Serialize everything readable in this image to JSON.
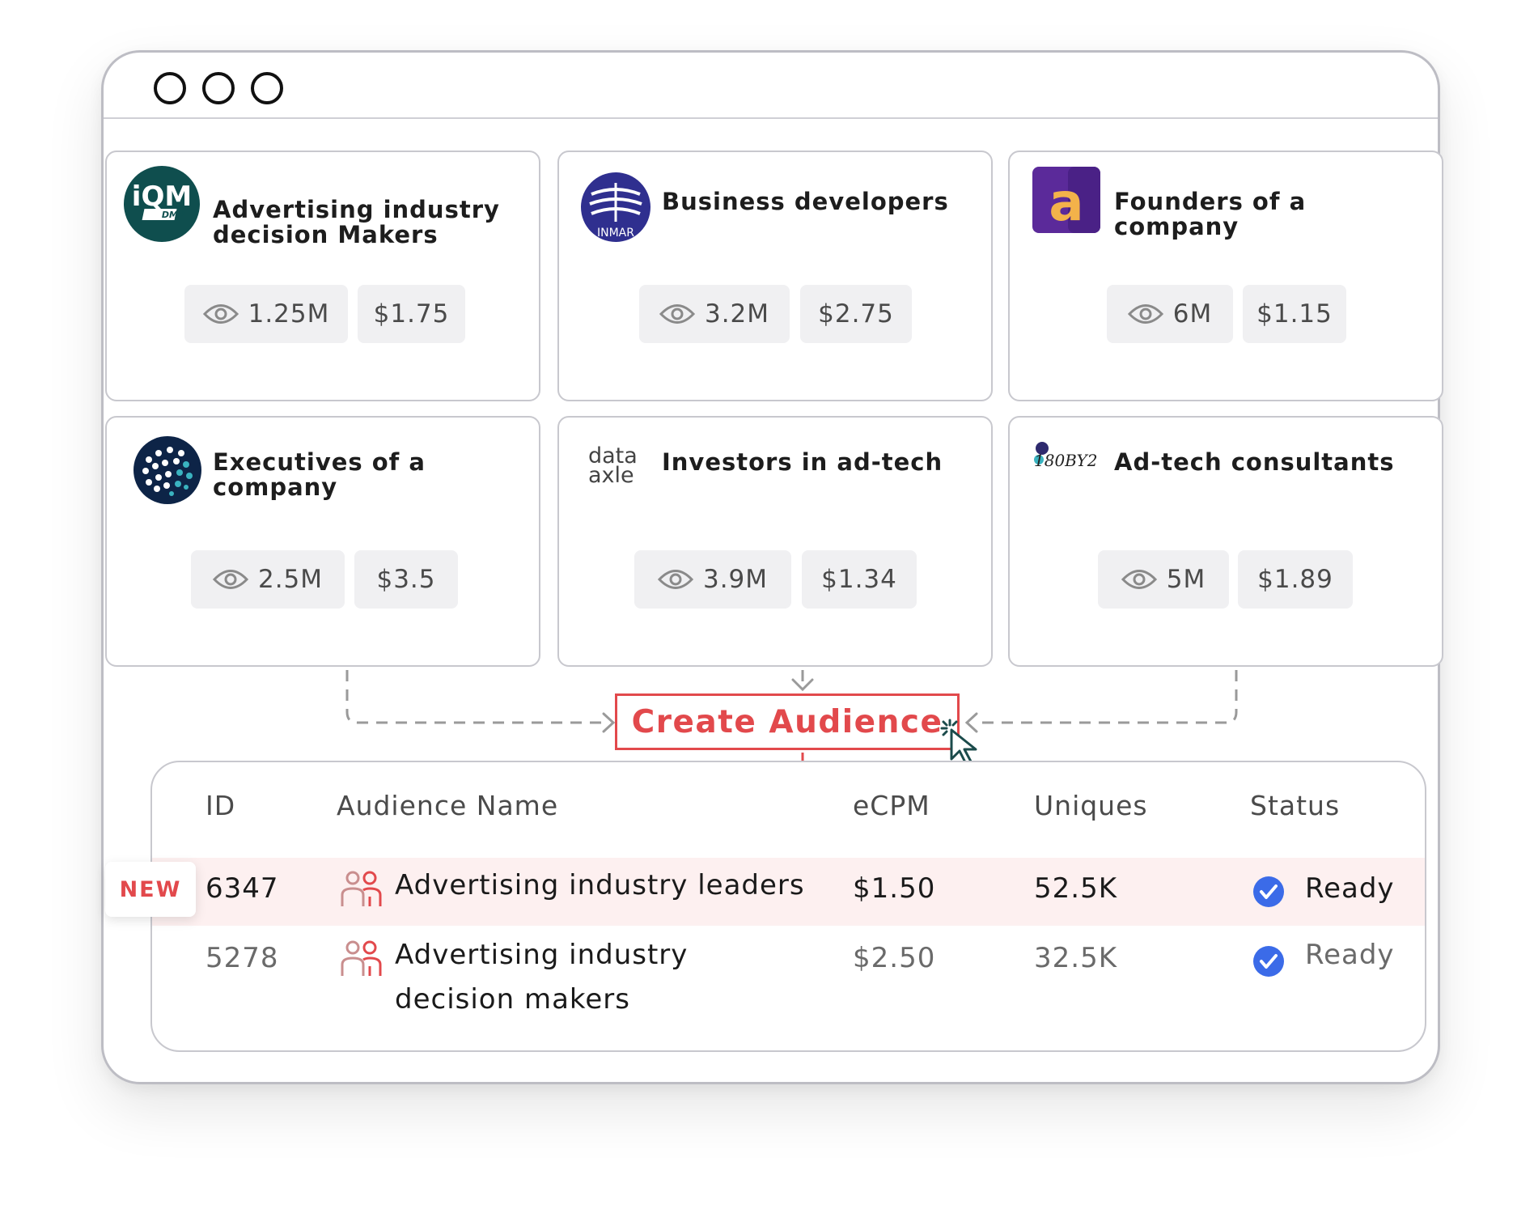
{
  "window": {
    "controls": [
      "window-dot-1",
      "window-dot-2",
      "window-dot-3"
    ]
  },
  "cards": [
    {
      "title_line1": "Advertising industry",
      "title_line2": "decision Makers",
      "logo": "iqm-dmp-logo",
      "logo_text": "iQM",
      "logo_sub": "DMP",
      "reach": "1.25M",
      "price": "$1.75"
    },
    {
      "title_line1": "Business developers",
      "title_line2": "",
      "logo": "inmar-logo",
      "logo_text": "INMAR",
      "reach": "3.2M",
      "price": "$2.75"
    },
    {
      "title_line1": "Founders of a",
      "title_line2": "company",
      "logo": "a-letter-logo",
      "logo_text": "a",
      "reach": "6M",
      "price": "$1.15"
    },
    {
      "title_line1": "Executives of a",
      "title_line2": "company",
      "logo": "dotted-globe-logo",
      "reach": "2.5M",
      "price": "$3.5"
    },
    {
      "title_line1": "Investors in ad-tech",
      "title_line2": "",
      "logo": "data-axle-logo",
      "logo_text": "data",
      "logo_sub": "axle",
      "reach": "3.9M",
      "price": "$1.34"
    },
    {
      "title_line1": "Ad-tech consultants",
      "title_line2": "",
      "logo": "180by2-logo",
      "logo_text": "180BY2",
      "reach": "5M",
      "price": "$1.89"
    }
  ],
  "create_button": {
    "label": "Create Audience"
  },
  "table": {
    "headers": {
      "id": "ID",
      "name": "Audience Name",
      "ecpm": "eCPM",
      "uniques": "Uniques",
      "status": "Status"
    },
    "new_badge": "NEW",
    "rows": [
      {
        "id": "6347",
        "name_line1": "Advertising industry leaders",
        "name_line2": "",
        "ecpm": "$1.50",
        "uniques": "52.5K",
        "status": "Ready"
      },
      {
        "id": "5278",
        "name_line1": "Advertising industry",
        "name_line2": "decision makers",
        "ecpm": "$2.50",
        "uniques": "32.5K",
        "status": "Ready"
      }
    ]
  },
  "colors": {
    "accent": "#e2494c",
    "check": "#3b6be8",
    "stat_bg": "#f0f0f2",
    "new_row_bg": "#fdf0f0"
  }
}
